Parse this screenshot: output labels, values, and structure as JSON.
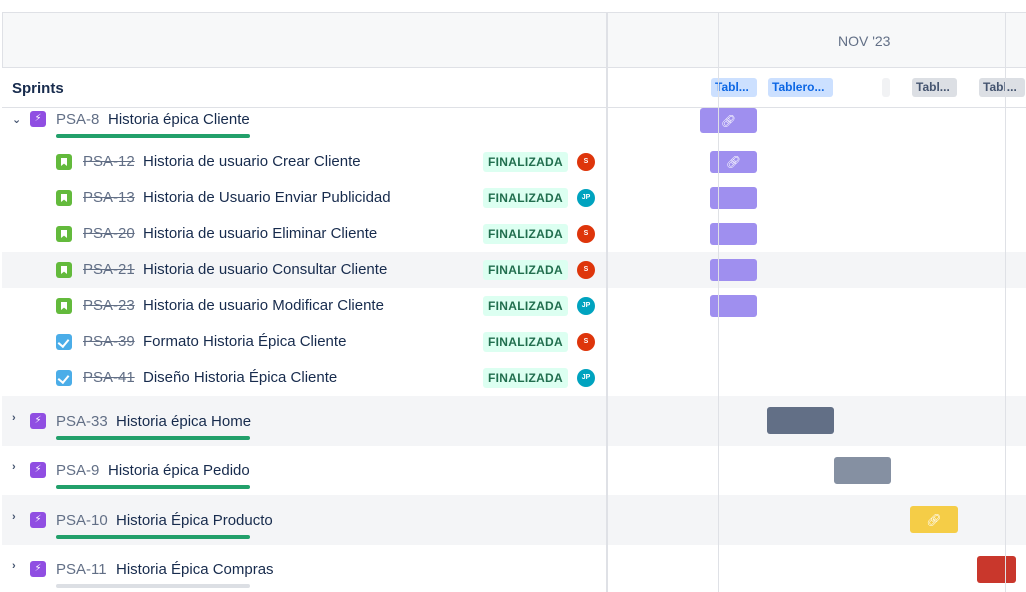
{
  "header": {
    "month": "NOV '23",
    "sprints_label": "Sprints"
  },
  "sprint_chips": [
    "Tabl...",
    "Tablero...",
    "",
    "Tabl...",
    "Tabl..."
  ],
  "epics": [
    {
      "key": "PSA-8",
      "title": "Historia épica Cliente",
      "expanded": true
    },
    {
      "key": "PSA-33",
      "title": "Historia épica Home",
      "expanded": false
    },
    {
      "key": "PSA-9",
      "title": "Historia épica Pedido",
      "expanded": false
    },
    {
      "key": "PSA-10",
      "title": "Historia Épica Producto",
      "expanded": false
    },
    {
      "key": "PSA-11",
      "title": "Historia Épica Compras",
      "expanded": false
    }
  ],
  "children": [
    {
      "key": "PSA-12",
      "title": "Historia de usuario Crear Cliente",
      "type": "story",
      "status": "FINALIZADA",
      "avatar": "S"
    },
    {
      "key": "PSA-13",
      "title": "Historia de Usuario Enviar Publicidad",
      "type": "story",
      "status": "FINALIZADA",
      "avatar": "JP"
    },
    {
      "key": "PSA-20",
      "title": "Historia de usuario Eliminar Cliente",
      "type": "story",
      "status": "FINALIZADA",
      "avatar": "S"
    },
    {
      "key": "PSA-21",
      "title": "Historia de usuario Consultar Cliente",
      "type": "story",
      "status": "FINALIZADA",
      "avatar": "S"
    },
    {
      "key": "PSA-23",
      "title": "Historia de usuario Modificar Cliente",
      "type": "story",
      "status": "FINALIZADA",
      "avatar": "JP"
    },
    {
      "key": "PSA-39",
      "title": "Formato Historia Épica Cliente",
      "type": "task",
      "status": "FINALIZADA",
      "avatar": "S"
    },
    {
      "key": "PSA-41",
      "title": "Diseño Historia Épica Cliente",
      "type": "task",
      "status": "FINALIZADA",
      "avatar": "JP"
    }
  ],
  "colors": {
    "epic_purple": "#904ee2",
    "bar_purple": "#9f8fef",
    "bar_slate": "#626f86",
    "bar_grey": "#8590a2",
    "bar_yellow": "#f5cd47",
    "bar_red": "#c9372c",
    "progress_green": "#22a06b"
  },
  "icons": {
    "expand": "chevron-down-icon",
    "collapse": "chevron-right-icon",
    "epic": "lightning-icon",
    "story": "bookmark-icon",
    "task": "checkbox-icon",
    "link": "link-icon"
  }
}
